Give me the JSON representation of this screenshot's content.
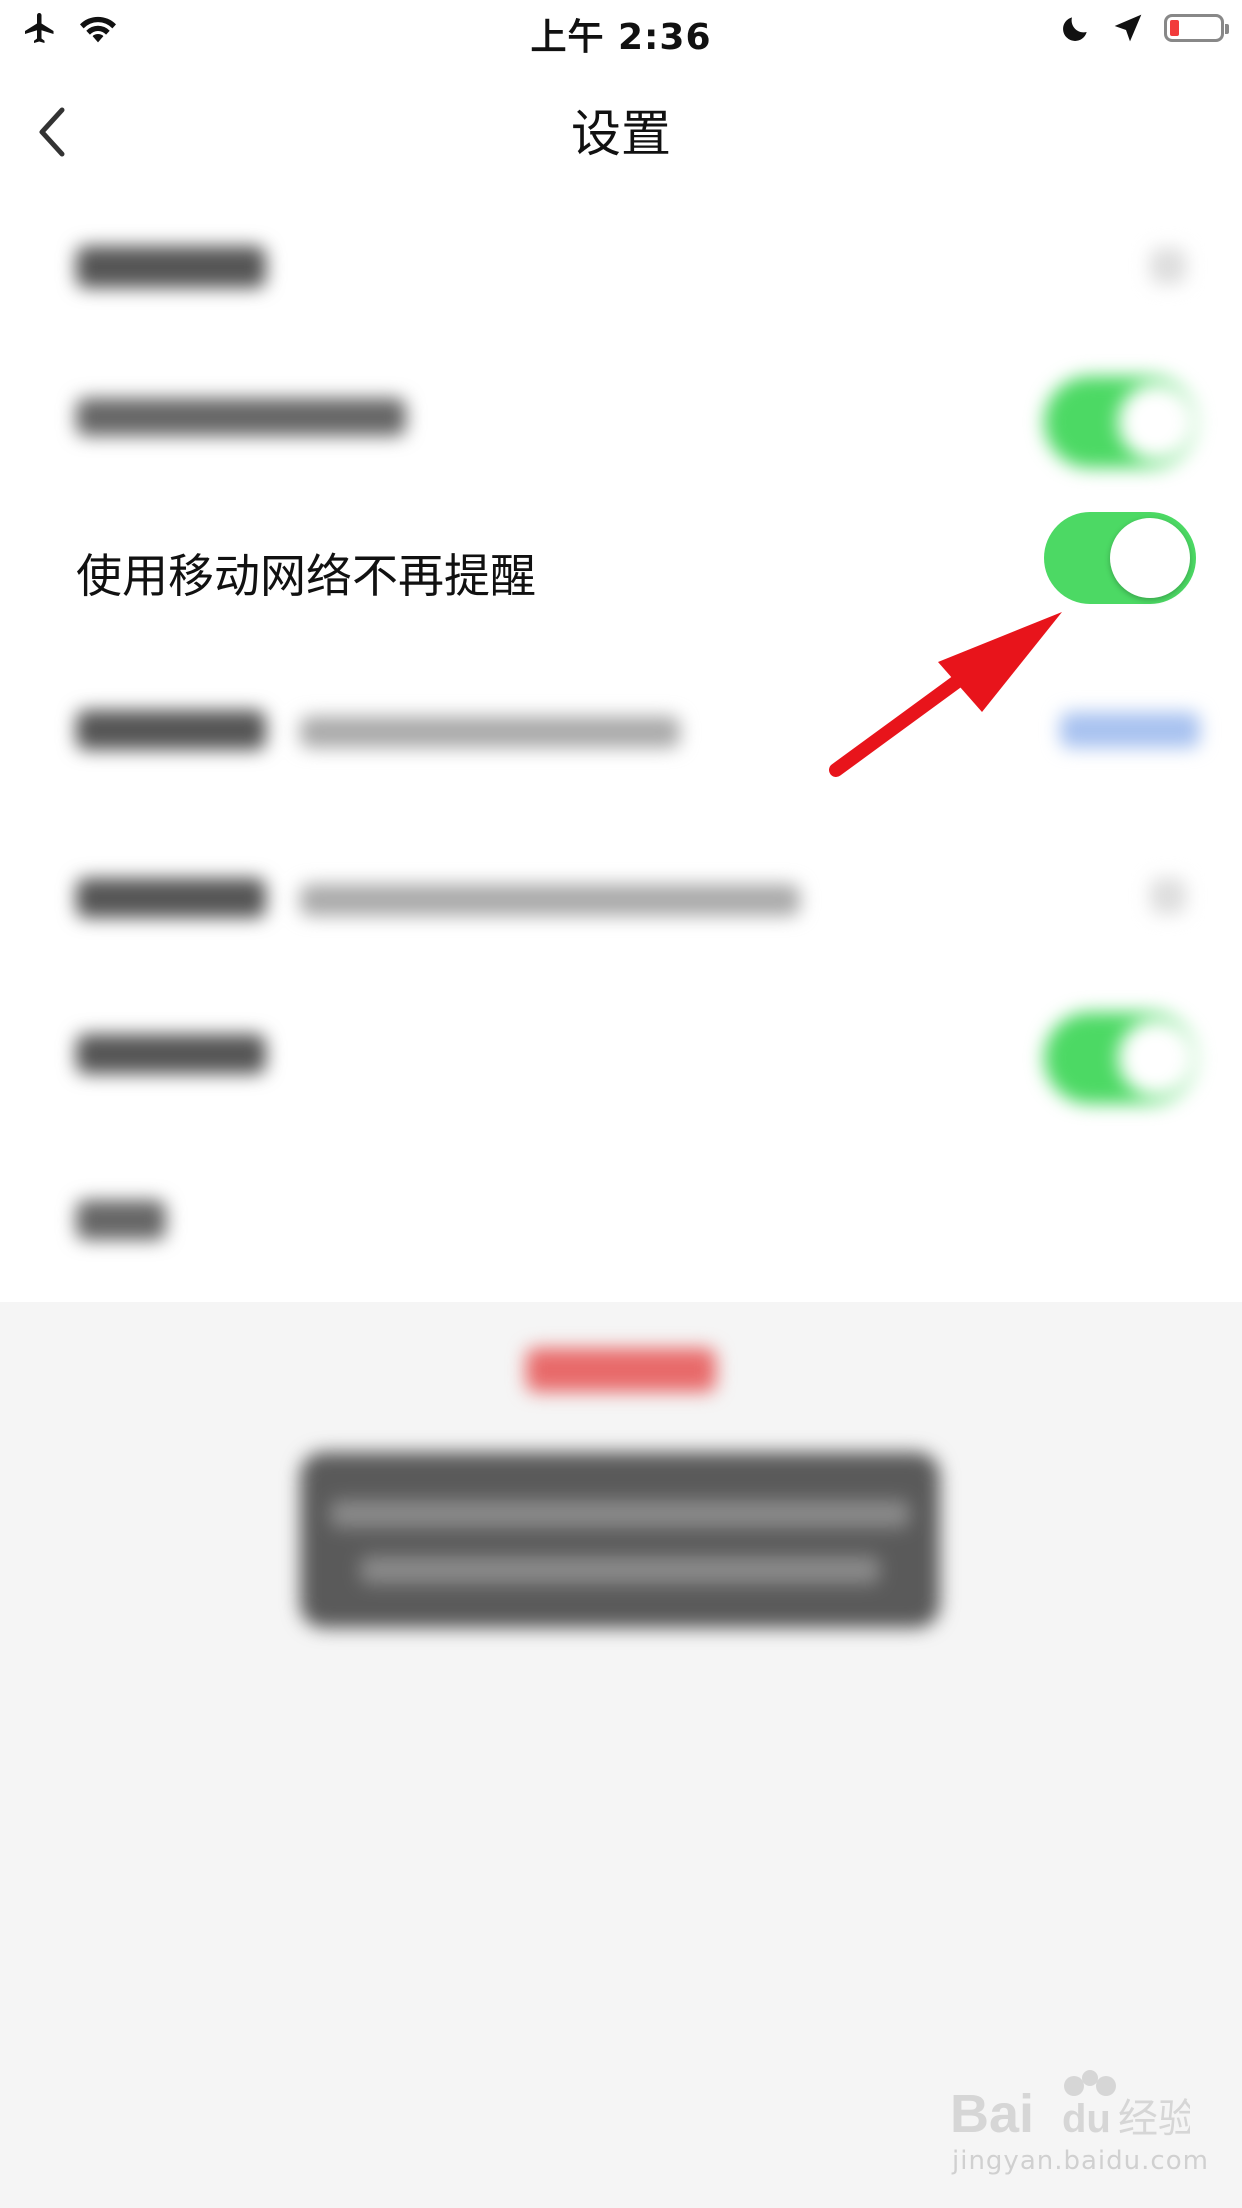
{
  "status_bar": {
    "time": "上午 2:36",
    "icons_left": [
      "airplane-icon",
      "wifi-icon"
    ],
    "icons_right": [
      "moon-icon",
      "location-icon",
      "battery-icon"
    ],
    "battery_level": 0.15,
    "battery_color": "#f23b3b"
  },
  "nav": {
    "title": "设置",
    "back_icon": "chevron-left-icon"
  },
  "focused_setting": {
    "label": "使用移动网络不再提醒",
    "toggle_on": true,
    "toggle_color": "#4cd964"
  },
  "annotation": {
    "arrow_color": "#e8141b"
  },
  "watermark": {
    "logo_text": "Bai du 经验",
    "url": "jingyan.baidu.com"
  }
}
